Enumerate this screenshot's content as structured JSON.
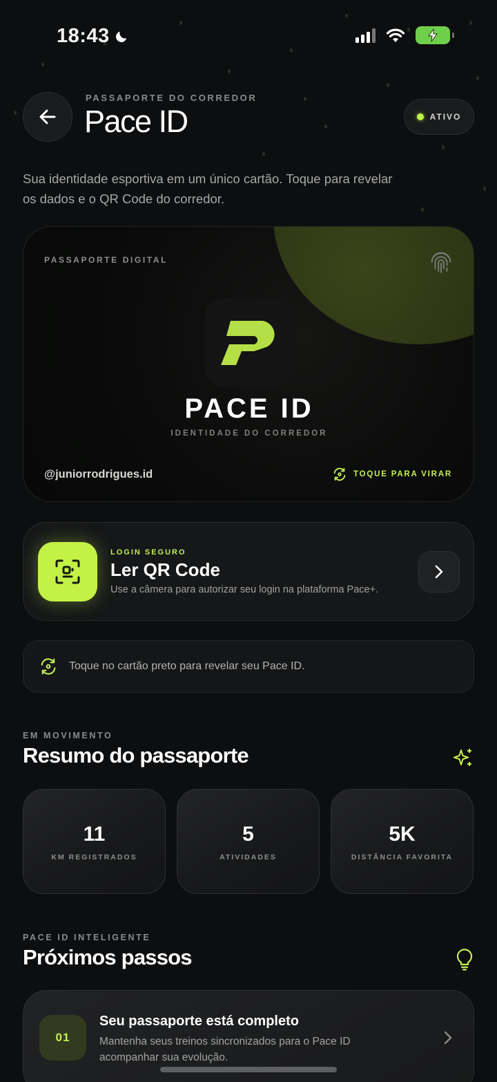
{
  "status_bar": {
    "time": "18:43"
  },
  "header": {
    "eyebrow": "PASSAPORTE DO CORREDOR",
    "title": "Pace ID",
    "status": "ATIVO"
  },
  "intro_text": "Sua identidade esportiva em um único cartão. Toque para revelar os dados e o QR Code do corredor.",
  "pass_card": {
    "eyebrow": "PASSAPORTE DIGITAL",
    "title": "PACE ID",
    "subtitle": "IDENTIDADE DO CORREDOR",
    "handle": "@juniorrodrigues.id",
    "flip_hint": "TOQUE PARA VIRAR"
  },
  "qr_login": {
    "eyebrow": "LOGIN SEGURO",
    "title": "Ler QR Code",
    "description": "Use a câmera para autorizar seu login na plataforma Pace+."
  },
  "hint_bar": {
    "text": "Toque no cartão preto para revelar seu Pace ID."
  },
  "summary": {
    "eyebrow": "EM MOVIMENTO",
    "title": "Resumo do passaporte",
    "stats": [
      {
        "value": "11",
        "label": "KM REGISTRADOS"
      },
      {
        "value": "5",
        "label": "ATIVIDADES"
      },
      {
        "value": "5K",
        "label": "DISTÂNCIA FAVORITA"
      }
    ]
  },
  "next_steps": {
    "eyebrow": "PACE ID INTELIGENTE",
    "title": "Próximos passos",
    "items": [
      {
        "number": "01",
        "title": "Seu passaporte está completo",
        "description": "Mantenha seus treinos sincronizados para o Pace ID acompanhar sua evolução."
      }
    ]
  },
  "colors": {
    "accent": "#c4f146",
    "background": "#0d0e10",
    "card": "#161718"
  },
  "icons": [
    "moon-icon",
    "signal-icon",
    "wifi-icon",
    "battery-icon",
    "back-arrow-icon",
    "fingerprint-icon",
    "pace-logo",
    "rotate-icon",
    "qr-scan-icon",
    "chevron-right-icon",
    "sparkle-icon",
    "lightbulb-icon"
  ]
}
